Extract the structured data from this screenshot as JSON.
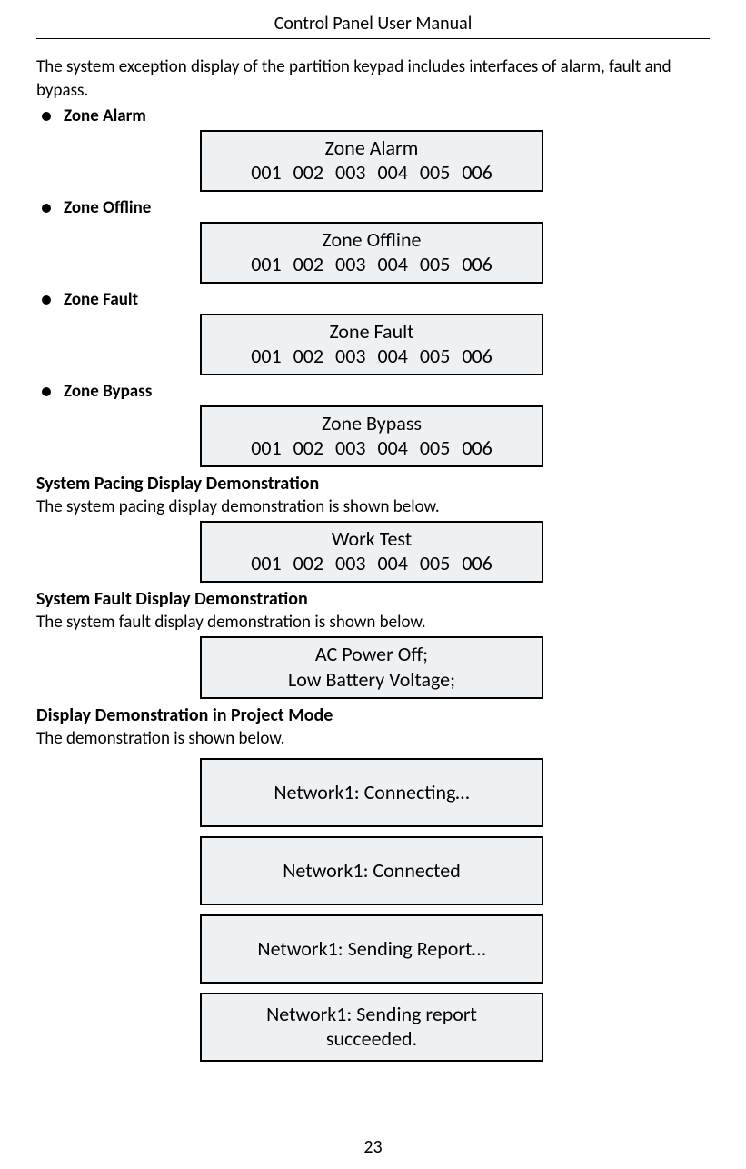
{
  "header": {
    "title": "Control Panel User Manual"
  },
  "intro": "The system exception display of the partition keypad includes interfaces of alarm, fault and bypass.",
  "bullets": {
    "zone_alarm": {
      "label": "Zone Alarm",
      "box": {
        "title": "Zone Alarm",
        "codes": "001 002 003 004 005 006"
      }
    },
    "zone_offline": {
      "label": "Zone Offline",
      "box": {
        "title": "Zone Offline",
        "codes": "001 002 003 004 005 006"
      }
    },
    "zone_fault": {
      "label": "Zone Fault",
      "box": {
        "title": "Zone Fault",
        "codes": "001 002 003 004 005 006"
      }
    },
    "zone_bypass": {
      "label": "Zone Bypass",
      "box": {
        "title": "Zone Bypass",
        "codes": "001 002 003 004 005 006"
      }
    }
  },
  "pacing": {
    "heading": "System Pacing Display Demonstration",
    "sub": "The system pacing display demonstration is shown below.",
    "box": {
      "title": "Work Test",
      "codes": "001 002 003 004 005 006"
    }
  },
  "fault": {
    "heading": "System Fault Display Demonstration",
    "sub": "The system fault display demonstration is shown below.",
    "box": {
      "line1": "AC Power Off;",
      "line2": "Low Battery Voltage;"
    }
  },
  "project": {
    "heading": "Display Demonstration in Project Mode",
    "sub": "The demonstration is shown below.",
    "boxes": {
      "b1": "Network1: Connecting…",
      "b2": "Network1: Connected",
      "b3": "Network1: Sending Report…",
      "b4_l1": "Network1: Sending report",
      "b4_l2": "succeeded."
    }
  },
  "page_number": "23"
}
